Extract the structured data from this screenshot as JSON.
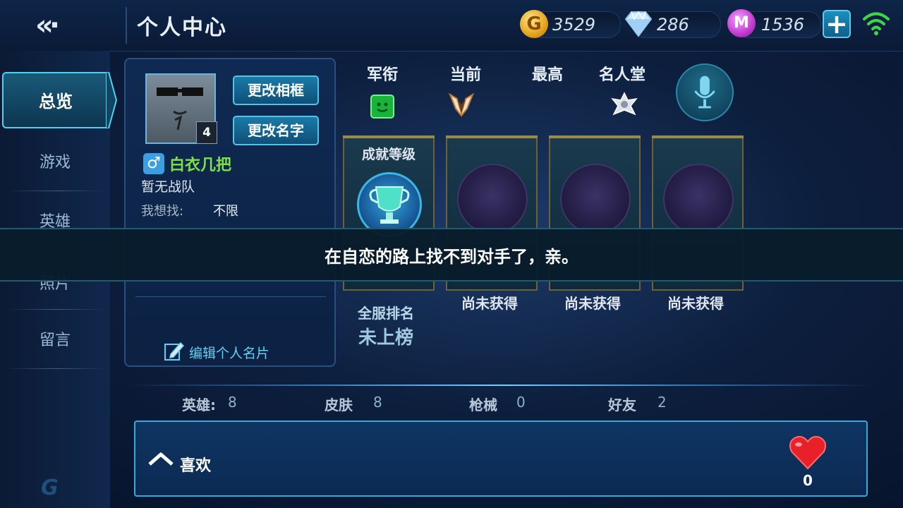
{
  "header": {
    "back_glyph": "«·",
    "title": "个人中心",
    "gold": "3529",
    "gold_icon": "G",
    "diamond": "286",
    "mcoin": "1536",
    "mcoin_icon": "M",
    "plus_glyph": "+"
  },
  "sidebar": {
    "items": [
      {
        "label": "总览",
        "active": true
      },
      {
        "label": "游戏"
      },
      {
        "label": "英雄"
      },
      {
        "label": "照片"
      },
      {
        "label": "留言"
      }
    ],
    "logo": "G"
  },
  "profile": {
    "change_frame": "更改相框",
    "change_name": "更改名字",
    "level": "4",
    "gender_glyph": "♂",
    "name": "白衣几把",
    "team": "暂无战队",
    "looking_for_label": "我想找:",
    "looking_for_value": "不限",
    "edit_card": "编辑个人名片"
  },
  "rank": {
    "headers": [
      "军衔",
      "当前",
      "最高",
      "名人堂"
    ],
    "achievement_label": "成就等级",
    "not_obtained": [
      "尚未获得",
      "尚未获得",
      "尚未获得"
    ],
    "server_rank_label": "全服排名",
    "server_rank_value": "未上榜"
  },
  "toast": "在自恋的路上找不到对手了，亲。",
  "stats": [
    {
      "label": "英雄:",
      "value": "8"
    },
    {
      "label": "皮肤",
      "value": "8"
    },
    {
      "label": "枪械",
      "value": "0"
    },
    {
      "label": "好友",
      "value": "2"
    }
  ],
  "like": {
    "label": "喜欢",
    "count": "0"
  },
  "colors": {
    "accent": "#4fd1f0",
    "name_green": "#7fe04a",
    "heart_red": "#e8202a"
  }
}
